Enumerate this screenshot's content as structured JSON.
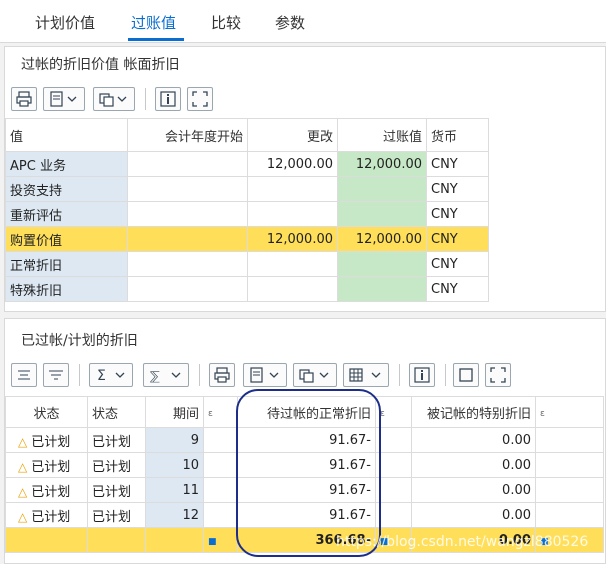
{
  "tabs": [
    {
      "label": "计划价值"
    },
    {
      "label": "过账值"
    },
    {
      "label": "比较"
    },
    {
      "label": "参数"
    }
  ],
  "section1": {
    "title": "过帐的折旧价值 帐面折旧",
    "headers": {
      "value": "值",
      "fy_start": "会计年度开始",
      "change": "更改",
      "posted": "过账值",
      "currency": "货币"
    },
    "rows": [
      {
        "label": "APC 业务",
        "fy_start": "",
        "change": "12,000.00",
        "posted": "12,000.00",
        "currency": "CNY"
      },
      {
        "label": "投资支持",
        "fy_start": "",
        "change": "",
        "posted": "",
        "currency": "CNY"
      },
      {
        "label": "重新评估",
        "fy_start": "",
        "change": "",
        "posted": "",
        "currency": "CNY"
      },
      {
        "label": "购置价值",
        "fy_start": "",
        "change": "12,000.00",
        "posted": "12,000.00",
        "currency": "CNY"
      },
      {
        "label": "正常折旧",
        "fy_start": "",
        "change": "",
        "posted": "",
        "currency": "CNY"
      },
      {
        "label": "特殊折旧",
        "fy_start": "",
        "change": "",
        "posted": "",
        "currency": "CNY"
      }
    ]
  },
  "section2": {
    "title": "已过帐/计划的折旧",
    "headers": {
      "status1": "状态",
      "status2": "状态",
      "period": "期间",
      "normal": "待过帐的正常折旧",
      "special": "被记帐的特别折旧"
    },
    "rows": [
      {
        "status1": "已计划",
        "status2": "已计划",
        "period": "9",
        "normal": "91.67-",
        "special": "0.00"
      },
      {
        "status1": "已计划",
        "status2": "已计划",
        "period": "10",
        "normal": "91.67-",
        "special": "0.00"
      },
      {
        "status1": "已计划",
        "status2": "已计划",
        "period": "11",
        "normal": "91.67-",
        "special": "0.00"
      },
      {
        "status1": "已计划",
        "status2": "已计划",
        "period": "12",
        "normal": "91.67-",
        "special": "0.00"
      }
    ],
    "total": {
      "normal": "366.68-",
      "special": "0.00"
    }
  },
  "watermark": "https://blog.csdn.net/wangzl880526",
  "colors": {
    "accent": "#0a6ed1",
    "green": "#c6e8c6",
    "yellow": "#ffdf5a",
    "rowhdr": "#dde8f3",
    "ring": "#1c2d8a"
  }
}
